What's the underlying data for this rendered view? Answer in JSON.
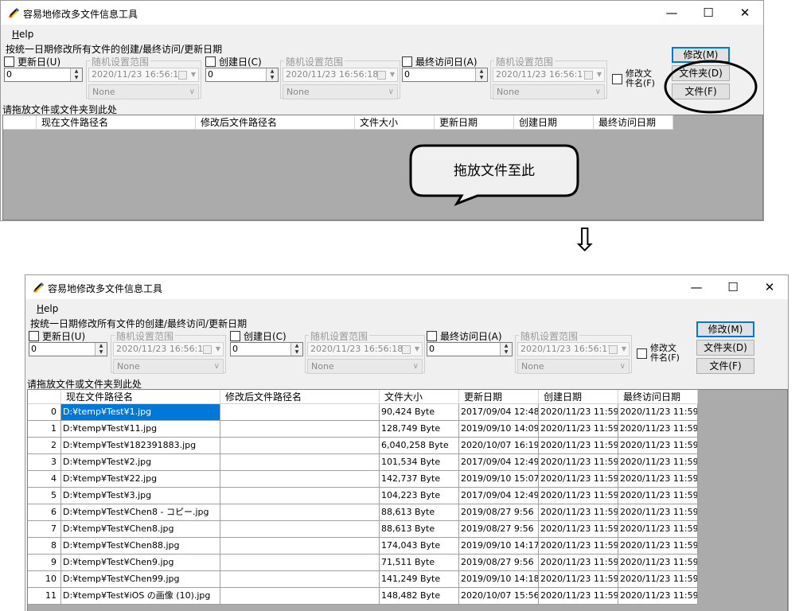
{
  "window": {
    "title": "容易地修改多文件信息工具",
    "minimize": "—",
    "maximize": "☐",
    "close": "✕",
    "menu_help": "Help",
    "uniform_hint": "按统一日期修改所有文件的创建/最终访问/更新日期",
    "update_check": "更新日(U)",
    "create_check": "创建日(C)",
    "access_check": "最终访问日(A)",
    "random_label": "随机设置范围",
    "update_days": "0",
    "create_days": "0",
    "access_days": "0",
    "update_date": "2020/11/23 16:56:18",
    "create_date": "2020/11/23 16:56:18",
    "access_date": "2020/11/23 16:56:17",
    "none_option": "None",
    "rename_check_line1": "修改文",
    "rename_check_line2": "件名(F)",
    "modify_button": "修改(M)",
    "folder_button": "文件夹(D)",
    "file_button": "文件(F)",
    "drop_hint": "请拖放文件或文件夹到此处",
    "columns": [
      "现在文件路径名",
      "修改后文件路径名",
      "文件大小",
      "更新日期",
      "创建日期",
      "最终访问日期"
    ]
  },
  "callout": {
    "drop_bubble": "拖放文件至此"
  },
  "arrow_glyph": "⇩",
  "accent_color": "#0078d7",
  "rows": [
    {
      "index": "0",
      "path": "D:¥temp¥Test¥1.jpg",
      "new_path": "",
      "size": "90,424 Byte",
      "updated": "2017/09/04 12:48",
      "created": "2020/11/23 11:59",
      "accessed": "2020/11/23 11:59"
    },
    {
      "index": "1",
      "path": "D:¥temp¥Test¥11.jpg",
      "new_path": "",
      "size": "128,749 Byte",
      "updated": "2019/09/10 14:09",
      "created": "2020/11/23 11:59",
      "accessed": "2020/11/23 11:59"
    },
    {
      "index": "2",
      "path": "D:¥temp¥Test¥182391883.jpg",
      "new_path": "",
      "size": "6,040,258 Byte",
      "updated": "2020/10/07 16:19",
      "created": "2020/11/23 11:59",
      "accessed": "2020/11/23 11:59"
    },
    {
      "index": "3",
      "path": "D:¥temp¥Test¥2.jpg",
      "new_path": "",
      "size": "101,534 Byte",
      "updated": "2017/09/04 12:49",
      "created": "2020/11/23 11:59",
      "accessed": "2020/11/23 11:59"
    },
    {
      "index": "4",
      "path": "D:¥temp¥Test¥22.jpg",
      "new_path": "",
      "size": "142,737 Byte",
      "updated": "2019/09/10 15:07",
      "created": "2020/11/23 11:59",
      "accessed": "2020/11/23 11:59"
    },
    {
      "index": "5",
      "path": "D:¥temp¥Test¥3.jpg",
      "new_path": "",
      "size": "104,223 Byte",
      "updated": "2017/09/04 12:49",
      "created": "2020/11/23 11:59",
      "accessed": "2020/11/23 11:59"
    },
    {
      "index": "6",
      "path": "D:¥temp¥Test¥Chen8 - コピー.jpg",
      "new_path": "",
      "size": "88,613 Byte",
      "updated": "2019/08/27 9:56",
      "created": "2020/11/23 11:59",
      "accessed": "2020/11/23 11:59"
    },
    {
      "index": "7",
      "path": "D:¥temp¥Test¥Chen8.jpg",
      "new_path": "",
      "size": "88,613 Byte",
      "updated": "2019/08/27 9:56",
      "created": "2020/11/23 11:59",
      "accessed": "2020/11/23 11:59"
    },
    {
      "index": "8",
      "path": "D:¥temp¥Test¥Chen88.jpg",
      "new_path": "",
      "size": "174,043 Byte",
      "updated": "2019/09/10 14:17",
      "created": "2020/11/23 11:59",
      "accessed": "2020/11/23 11:59"
    },
    {
      "index": "9",
      "path": "D:¥temp¥Test¥Chen9.jpg",
      "new_path": "",
      "size": "71,511 Byte",
      "updated": "2019/08/27 9:56",
      "created": "2020/11/23 11:59",
      "accessed": "2020/11/23 11:59"
    },
    {
      "index": "10",
      "path": "D:¥temp¥Test¥Chen99.jpg",
      "new_path": "",
      "size": "141,249 Byte",
      "updated": "2019/09/10 14:18",
      "created": "2020/11/23 11:59",
      "accessed": "2020/11/23 11:59"
    },
    {
      "index": "11",
      "path": "D:¥temp¥Test¥iOS の画像 (10).jpg",
      "new_path": "",
      "size": "148,482 Byte",
      "updated": "2020/10/07 15:56",
      "created": "2020/11/23 11:59",
      "accessed": "2020/11/23 11:59"
    }
  ]
}
